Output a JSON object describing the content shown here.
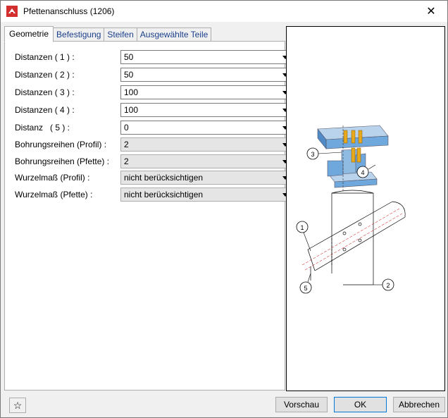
{
  "window": {
    "title": "Pfettenanschluss (1206)"
  },
  "tabs": [
    {
      "label": "Geometrie"
    },
    {
      "label": "Befestigung"
    },
    {
      "label": "Steifen"
    },
    {
      "label": "Ausgewählte Teile"
    }
  ],
  "fields": [
    {
      "label": "Distanzen ( 1 ) :",
      "value": "50"
    },
    {
      "label": "Distanzen ( 2 ) :",
      "value": "50"
    },
    {
      "label": "Distanzen ( 3 ) :",
      "value": "100"
    },
    {
      "label": "Distanzen ( 4 ) :",
      "value": "100"
    },
    {
      "label": "Distanz   ( 5 ) :",
      "value": "0"
    },
    {
      "label": "Bohrungsreihen (Profil) :",
      "value": "2"
    },
    {
      "label": "Bohrungsreihen (Pfette) :",
      "value": "2"
    },
    {
      "label": "Wurzelmaß (Profil) :",
      "value": "nicht berücksichtigen"
    },
    {
      "label": "Wurzelmaß (Pfette) :",
      "value": "nicht berücksichtigen"
    }
  ],
  "preview": {
    "callouts": [
      "1",
      "2",
      "3",
      "4",
      "5"
    ]
  },
  "buttons": {
    "preview": "Vorschau",
    "ok": "OK",
    "cancel": "Abbrechen"
  },
  "colors": {
    "beam_blue": "#6fa8dc",
    "stiffener_orange": "#e8a91c",
    "accent": "#0078d7"
  }
}
